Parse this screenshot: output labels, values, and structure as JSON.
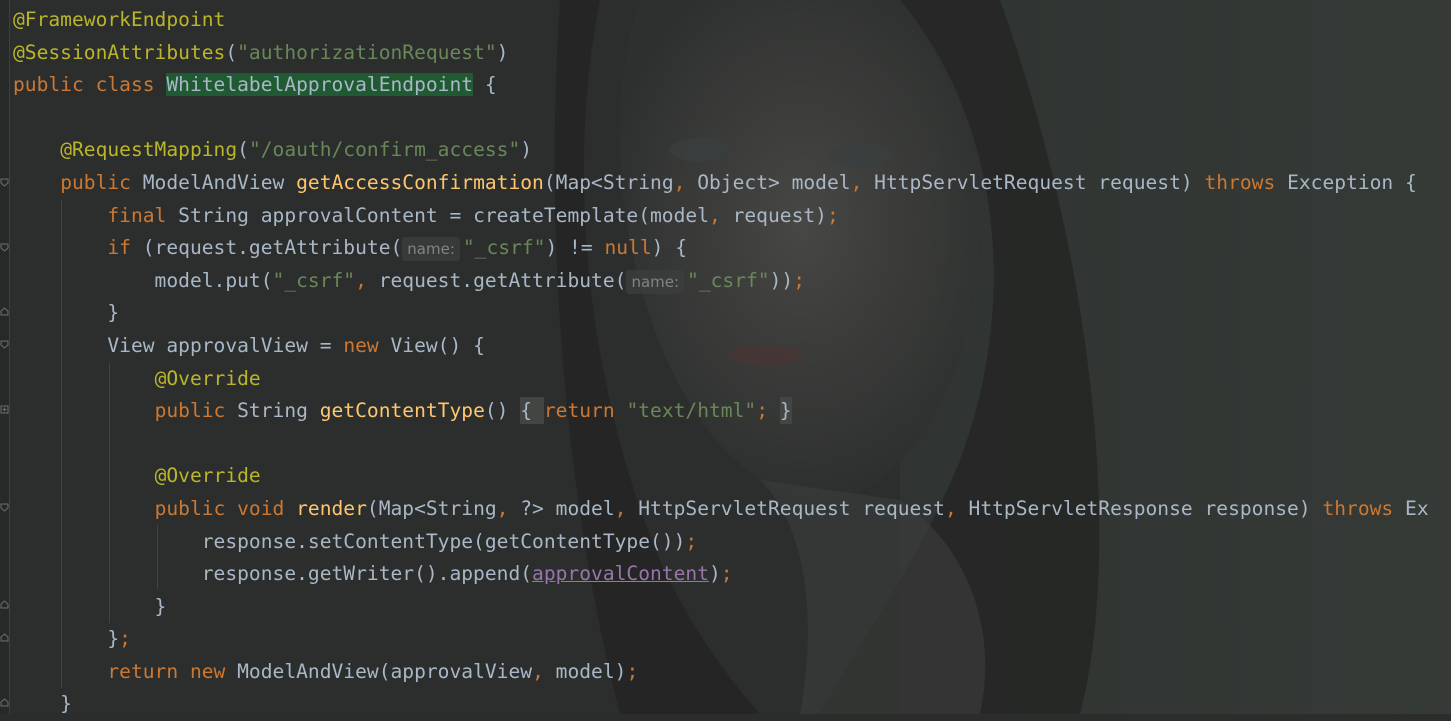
{
  "editor": {
    "background": "#2b2e2d",
    "accent_selection": "#1f5a33",
    "lines": [
      [
        {
          "c": "ann",
          "t": "@FrameworkEndpoint"
        }
      ],
      [
        {
          "c": "ann",
          "t": "@SessionAttributes"
        },
        {
          "c": "def",
          "t": "("
        },
        {
          "c": "str",
          "t": "\"authorizationRequest\""
        },
        {
          "c": "def",
          "t": ")"
        }
      ],
      [
        {
          "c": "kw",
          "t": "public class "
        },
        {
          "c": "sel",
          "t": "WhitelabelApprovalEndpoint"
        },
        {
          "c": "def",
          "t": " {"
        }
      ],
      [],
      [
        {
          "c": "def",
          "t": "    "
        },
        {
          "c": "ann",
          "t": "@RequestMapping"
        },
        {
          "c": "def",
          "t": "("
        },
        {
          "c": "str",
          "t": "\"/oauth/confirm_access\""
        },
        {
          "c": "def",
          "t": ")"
        }
      ],
      [
        {
          "c": "def",
          "t": "    "
        },
        {
          "c": "kw",
          "t": "public "
        },
        {
          "c": "def",
          "t": "ModelAndView "
        },
        {
          "c": "fn",
          "t": "getAccessConfirmation"
        },
        {
          "c": "def",
          "t": "(Map<String"
        },
        {
          "c": "kw",
          "t": ", "
        },
        {
          "c": "def",
          "t": "Object> model"
        },
        {
          "c": "kw",
          "t": ", "
        },
        {
          "c": "def",
          "t": "HttpServletRequest request) "
        },
        {
          "c": "kw",
          "t": "throws "
        },
        {
          "c": "def",
          "t": "Exception {"
        }
      ],
      [
        {
          "c": "def",
          "t": "        "
        },
        {
          "c": "kw",
          "t": "final "
        },
        {
          "c": "def",
          "t": "String approvalContent = createTemplate(model"
        },
        {
          "c": "kw",
          "t": ", "
        },
        {
          "c": "def",
          "t": "request)"
        },
        {
          "c": "kw",
          "t": ";"
        }
      ],
      [
        {
          "c": "def",
          "t": "        "
        },
        {
          "c": "kw",
          "t": "if "
        },
        {
          "c": "def",
          "t": "(request.getAttribute("
        },
        {
          "c": "hint",
          "t": "name:"
        },
        {
          "c": "str",
          "t": "\"_csrf\""
        },
        {
          "c": "def",
          "t": ") != "
        },
        {
          "c": "kw",
          "t": "null"
        },
        {
          "c": "def",
          "t": ") {"
        }
      ],
      [
        {
          "c": "def",
          "t": "            model.put("
        },
        {
          "c": "str",
          "t": "\"_csrf\""
        },
        {
          "c": "kw",
          "t": ", "
        },
        {
          "c": "def",
          "t": "request.getAttribute("
        },
        {
          "c": "hint",
          "t": "name:"
        },
        {
          "c": "str",
          "t": "\"_csrf\""
        },
        {
          "c": "def",
          "t": "))"
        },
        {
          "c": "kw",
          "t": ";"
        }
      ],
      [
        {
          "c": "def",
          "t": "        }"
        }
      ],
      [
        {
          "c": "def",
          "t": "        View approvalView = "
        },
        {
          "c": "kw",
          "t": "new "
        },
        {
          "c": "def",
          "t": "View() {"
        }
      ],
      [
        {
          "c": "def",
          "t": "            "
        },
        {
          "c": "ann",
          "t": "@Override"
        }
      ],
      [
        {
          "c": "def",
          "t": "            "
        },
        {
          "c": "kw",
          "t": "public "
        },
        {
          "c": "def",
          "t": "String "
        },
        {
          "c": "fn",
          "t": "getContentType"
        },
        {
          "c": "def",
          "t": "() "
        },
        {
          "c": "brace-hl",
          "t": "{ "
        },
        {
          "c": "kw",
          "t": "return "
        },
        {
          "c": "str",
          "t": "\"text/html\""
        },
        {
          "c": "kw",
          "t": "; "
        },
        {
          "c": "brace-hl",
          "t": "}"
        }
      ],
      [],
      [
        {
          "c": "def",
          "t": "            "
        },
        {
          "c": "ann",
          "t": "@Override"
        }
      ],
      [
        {
          "c": "def",
          "t": "            "
        },
        {
          "c": "kw",
          "t": "public void "
        },
        {
          "c": "fn",
          "t": "render"
        },
        {
          "c": "def",
          "t": "(Map<String"
        },
        {
          "c": "kw",
          "t": ", "
        },
        {
          "c": "def",
          "t": "?> model"
        },
        {
          "c": "kw",
          "t": ", "
        },
        {
          "c": "def",
          "t": "HttpServletRequest request"
        },
        {
          "c": "kw",
          "t": ", "
        },
        {
          "c": "def",
          "t": "HttpServletResponse response) "
        },
        {
          "c": "kw",
          "t": "throws "
        },
        {
          "c": "def",
          "t": "Ex"
        }
      ],
      [
        {
          "c": "def",
          "t": "                response.setContentType(getContentType())"
        },
        {
          "c": "kw",
          "t": ";"
        }
      ],
      [
        {
          "c": "def",
          "t": "                response.getWriter().append("
        },
        {
          "c": "fld",
          "t": "approvalContent"
        },
        {
          "c": "def",
          "t": ")"
        },
        {
          "c": "kw",
          "t": ";"
        }
      ],
      [
        {
          "c": "def",
          "t": "            }"
        }
      ],
      [
        {
          "c": "def",
          "t": "        }"
        },
        {
          "c": "kw",
          "t": ";"
        }
      ],
      [
        {
          "c": "def",
          "t": "        "
        },
        {
          "c": "kw",
          "t": "return new "
        },
        {
          "c": "def",
          "t": "ModelAndView(approvalView"
        },
        {
          "c": "kw",
          "t": ", "
        },
        {
          "c": "def",
          "t": "model)"
        },
        {
          "c": "kw",
          "t": ";"
        }
      ],
      [
        {
          "c": "def",
          "t": "    }"
        }
      ]
    ]
  }
}
